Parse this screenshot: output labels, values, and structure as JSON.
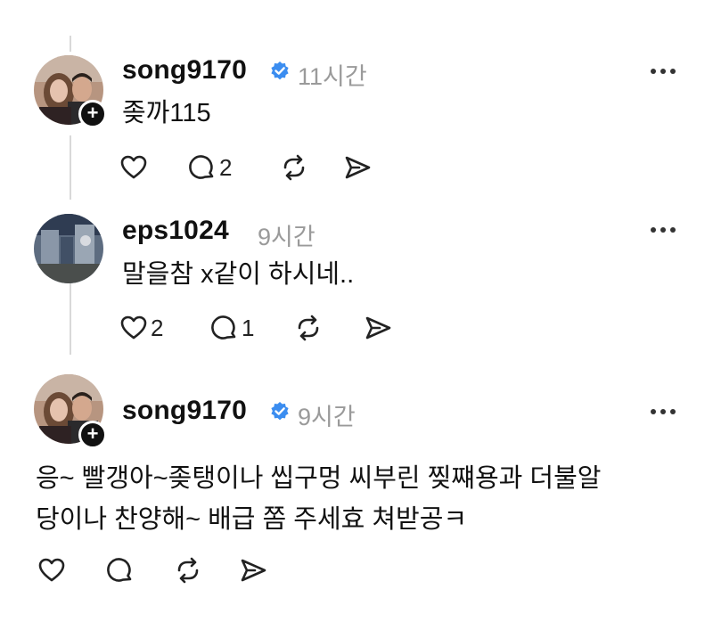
{
  "posts": [
    {
      "username": "song9170",
      "verified": true,
      "time": "11시간",
      "text": "좆까115",
      "likes": "",
      "replies": "2",
      "show_follow": true
    },
    {
      "username": "eps1024",
      "verified": false,
      "time": "9시간",
      "text": "말을참 x같이 하시네..",
      "likes": "2",
      "replies": "1",
      "show_follow": false
    },
    {
      "username": "song9170",
      "verified": true,
      "time": "9시간",
      "text_lines": [
        "응~ 빨갱아~좆탱이나 씹구멍 씨부린 찢쨰용과 더불알",
        "당이나 찬양해~ 배급 쫌 주세효 쳐받공ㅋ"
      ],
      "likes": "",
      "replies": "",
      "show_follow": true
    }
  ],
  "icons": {
    "like": "heart-icon",
    "reply": "comment-icon",
    "repost": "repost-icon",
    "share": "share-icon",
    "more": "more-icon",
    "verified": "verified-badge-icon",
    "follow": "plus-icon"
  },
  "colors": {
    "verified": "#3b8df0",
    "muted": "#9a9a9a",
    "thread_line": "#d9d9d9"
  }
}
